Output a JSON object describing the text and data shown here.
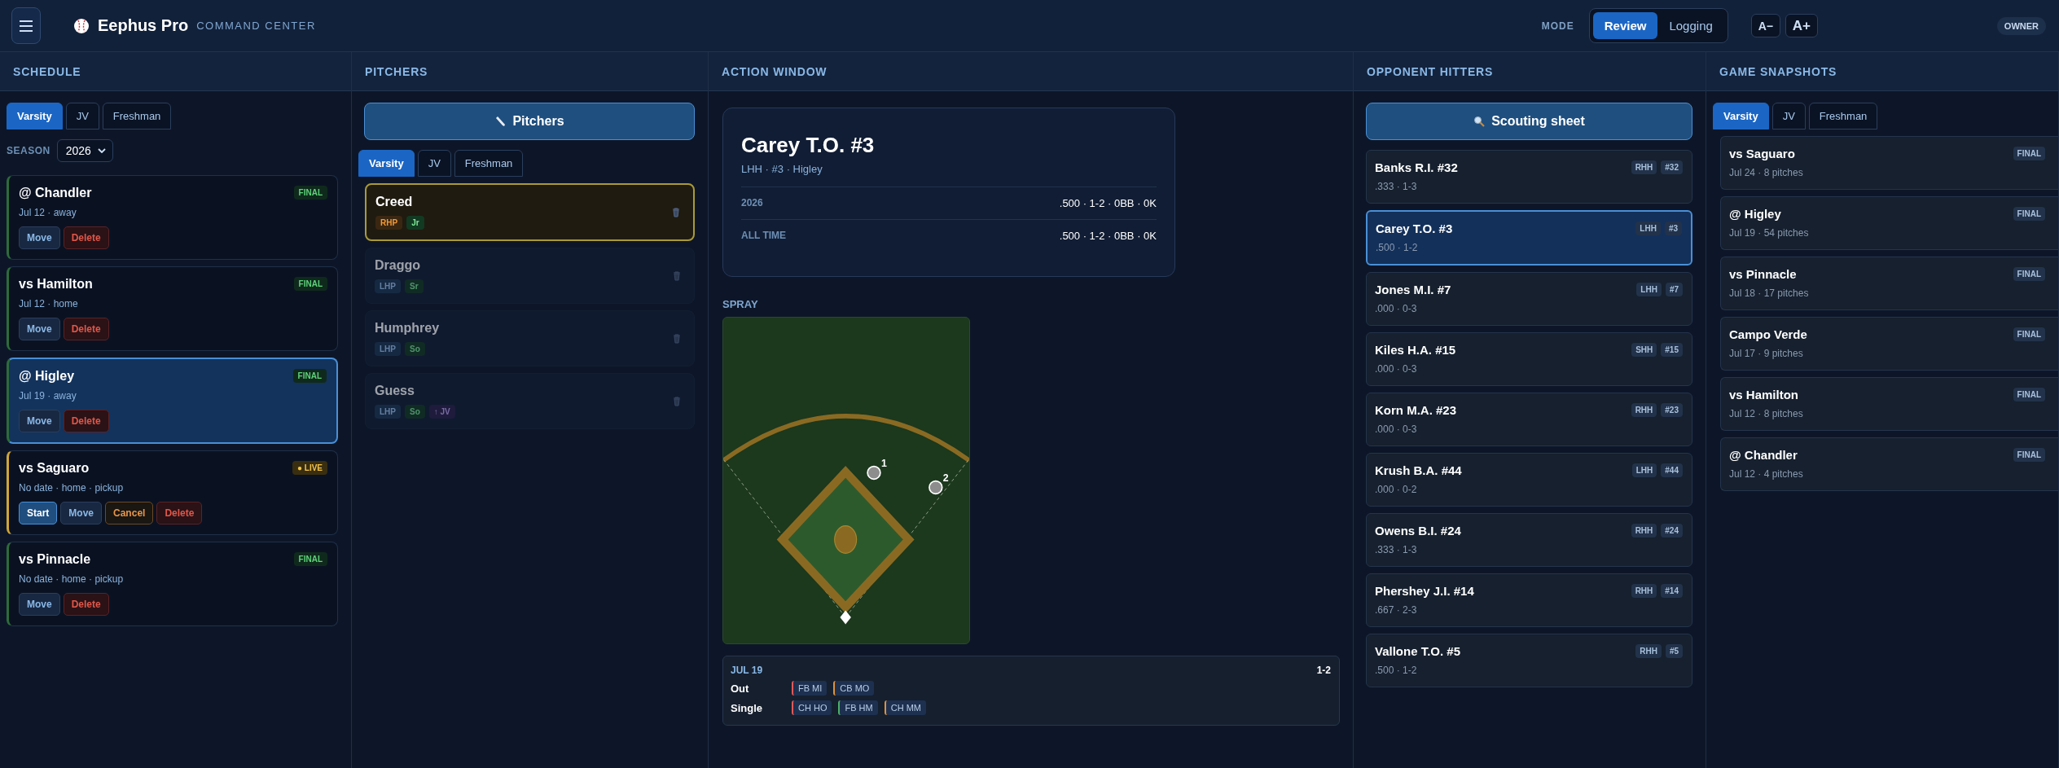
{
  "header": {
    "app_name": "Eephus Pro",
    "subtitle": "COMMAND CENTER",
    "mode_label": "MODE",
    "modes": [
      {
        "label": "Review",
        "selected": true
      },
      {
        "label": "Logging",
        "selected": false
      }
    ],
    "font_buttons": [
      "A−",
      "A+"
    ],
    "role": "OWNER"
  },
  "schedule": {
    "title": "SCHEDULE",
    "tabs": [
      {
        "label": "Varsity",
        "selected": true
      },
      {
        "label": "JV",
        "selected": false
      },
      {
        "label": "Freshman",
        "selected": false
      }
    ],
    "season_label": "SEASON",
    "season_value": "2026",
    "games": [
      {
        "title": "@ Chandler",
        "meta": "Jul 12 · away",
        "kind": "final",
        "badge": "FINAL",
        "selected": false,
        "actions": [
          {
            "label": "Move",
            "kind": "move"
          },
          {
            "label": "Delete",
            "kind": "delete"
          }
        ]
      },
      {
        "title": "vs Hamilton",
        "meta": "Jul 12 · home",
        "kind": "final",
        "badge": "FINAL",
        "selected": false,
        "actions": [
          {
            "label": "Move",
            "kind": "move"
          },
          {
            "label": "Delete",
            "kind": "delete"
          }
        ]
      },
      {
        "title": "@ Higley",
        "meta": "Jul 19 · away",
        "kind": "final",
        "badge": "FINAL",
        "selected": true,
        "actions": [
          {
            "label": "Move",
            "kind": "move"
          },
          {
            "label": "Delete",
            "kind": "delete"
          }
        ]
      },
      {
        "title": "vs Saguaro",
        "meta": "No date · home · pickup",
        "kind": "live",
        "badge": "● LIVE",
        "selected": false,
        "actions": [
          {
            "label": "Start",
            "kind": "start"
          },
          {
            "label": "Move",
            "kind": "move"
          },
          {
            "label": "Cancel",
            "kind": "cancel"
          },
          {
            "label": "Delete",
            "kind": "delete"
          }
        ]
      },
      {
        "title": "vs Pinnacle",
        "meta": "No date · home · pickup",
        "kind": "final",
        "badge": "FINAL",
        "selected": false,
        "actions": [
          {
            "label": "Move",
            "kind": "move"
          },
          {
            "label": "Delete",
            "kind": "delete"
          }
        ]
      }
    ]
  },
  "pitchers": {
    "title": "PITCHERS",
    "button": "Pitchers",
    "tabs": [
      {
        "label": "Varsity",
        "selected": true
      },
      {
        "label": "JV",
        "selected": false
      },
      {
        "label": "Freshman",
        "selected": false
      }
    ],
    "items": [
      {
        "name": "Creed",
        "selected": true,
        "tags": [
          {
            "label": "RHP",
            "kind": "throws"
          },
          {
            "label": "Jr",
            "kind": "class"
          }
        ]
      },
      {
        "name": "Draggo",
        "selected": false,
        "tags": [
          {
            "label": "LHP",
            "kind": "throws"
          },
          {
            "label": "Sr",
            "kind": "class"
          }
        ]
      },
      {
        "name": "Humphrey",
        "selected": false,
        "tags": [
          {
            "label": "LHP",
            "kind": "throws"
          },
          {
            "label": "So",
            "kind": "class"
          }
        ]
      },
      {
        "name": "Guess",
        "selected": false,
        "tags": [
          {
            "label": "LHP",
            "kind": "throws"
          },
          {
            "label": "So",
            "kind": "class"
          },
          {
            "label": "↑ JV",
            "kind": "moved"
          }
        ]
      }
    ]
  },
  "action_window": {
    "title": "ACTION WINDOW",
    "player": {
      "name": "Carey T.O. #3",
      "meta": "LHH · #3 · Higley",
      "stats": [
        {
          "label": "2026",
          "value": ".500 · 1-2 · 0BB · 0K"
        },
        {
          "label": "ALL TIME",
          "value": ".500 · 1-2 · 0BB · 0K"
        }
      ]
    },
    "spray_label": "SPRAY",
    "spray_points": [
      {
        "label": "1"
      },
      {
        "label": "2"
      }
    ],
    "log": {
      "date": "JUL 19",
      "score": "1-2",
      "rows": [
        {
          "result": "Out",
          "pitches": [
            {
              "label": "FB MI",
              "color": "#e05a5a"
            },
            {
              "label": "CB MO",
              "color": "#e0913a"
            }
          ]
        },
        {
          "result": "Single",
          "pitches": [
            {
              "label": "CH HO",
              "color": "#e05a5a"
            },
            {
              "label": "FB HM",
              "color": "#4caf6a"
            },
            {
              "label": "CH MM",
              "color": "#e0913a"
            }
          ]
        }
      ]
    }
  },
  "opponent_hitters": {
    "title": "OPPONENT HITTERS",
    "button": "Scouting sheet",
    "hitters": [
      {
        "name": "Banks R.I. #32",
        "stats": ".333 · 1-3",
        "hand": "RHH",
        "number": "#32",
        "selected": false
      },
      {
        "name": "Carey T.O. #3",
        "stats": ".500 · 1-2",
        "hand": "LHH",
        "number": "#3",
        "selected": true
      },
      {
        "name": "Jones M.I. #7",
        "stats": ".000 · 0-3",
        "hand": "LHH",
        "number": "#7",
        "selected": false
      },
      {
        "name": "Kiles H.A. #15",
        "stats": ".000 · 0-3",
        "hand": "SHH",
        "number": "#15",
        "selected": false
      },
      {
        "name": "Korn M.A. #23",
        "stats": ".000 · 0-3",
        "hand": "RHH",
        "number": "#23",
        "selected": false
      },
      {
        "name": "Krush B.A. #44",
        "stats": ".000 · 0-2",
        "hand": "LHH",
        "number": "#44",
        "selected": false
      },
      {
        "name": "Owens B.I. #24",
        "stats": ".333 · 1-3",
        "hand": "RHH",
        "number": "#24",
        "selected": false
      },
      {
        "name": "Phershey J.I. #14",
        "stats": ".667 · 2-3",
        "hand": "RHH",
        "number": "#14",
        "selected": false
      },
      {
        "name": "Vallone T.O. #5",
        "stats": ".500 · 1-2",
        "hand": "RHH",
        "number": "#5",
        "selected": false
      }
    ]
  },
  "game_snapshots": {
    "title": "GAME SNAPSHOTS",
    "tabs": [
      {
        "label": "Varsity",
        "selected": true
      },
      {
        "label": "JV",
        "selected": false
      },
      {
        "label": "Freshman",
        "selected": false
      }
    ],
    "games": [
      {
        "title": "vs Saguaro",
        "meta": "Jul 24 · 8 pitches",
        "badge": "FINAL"
      },
      {
        "title": "@ Higley",
        "meta": "Jul 19 · 54 pitches",
        "badge": "FINAL"
      },
      {
        "title": "vs Pinnacle",
        "meta": "Jul 18 · 17 pitches",
        "badge": "FINAL"
      },
      {
        "title": "Campo Verde",
        "meta": "Jul 17 · 9 pitches",
        "badge": "FINAL"
      },
      {
        "title": "vs Hamilton",
        "meta": "Jul 12 · 8 pitches",
        "badge": "FINAL"
      },
      {
        "title": "@ Chandler",
        "meta": "Jul 12 · 4 pitches",
        "badge": "FINAL"
      }
    ]
  }
}
